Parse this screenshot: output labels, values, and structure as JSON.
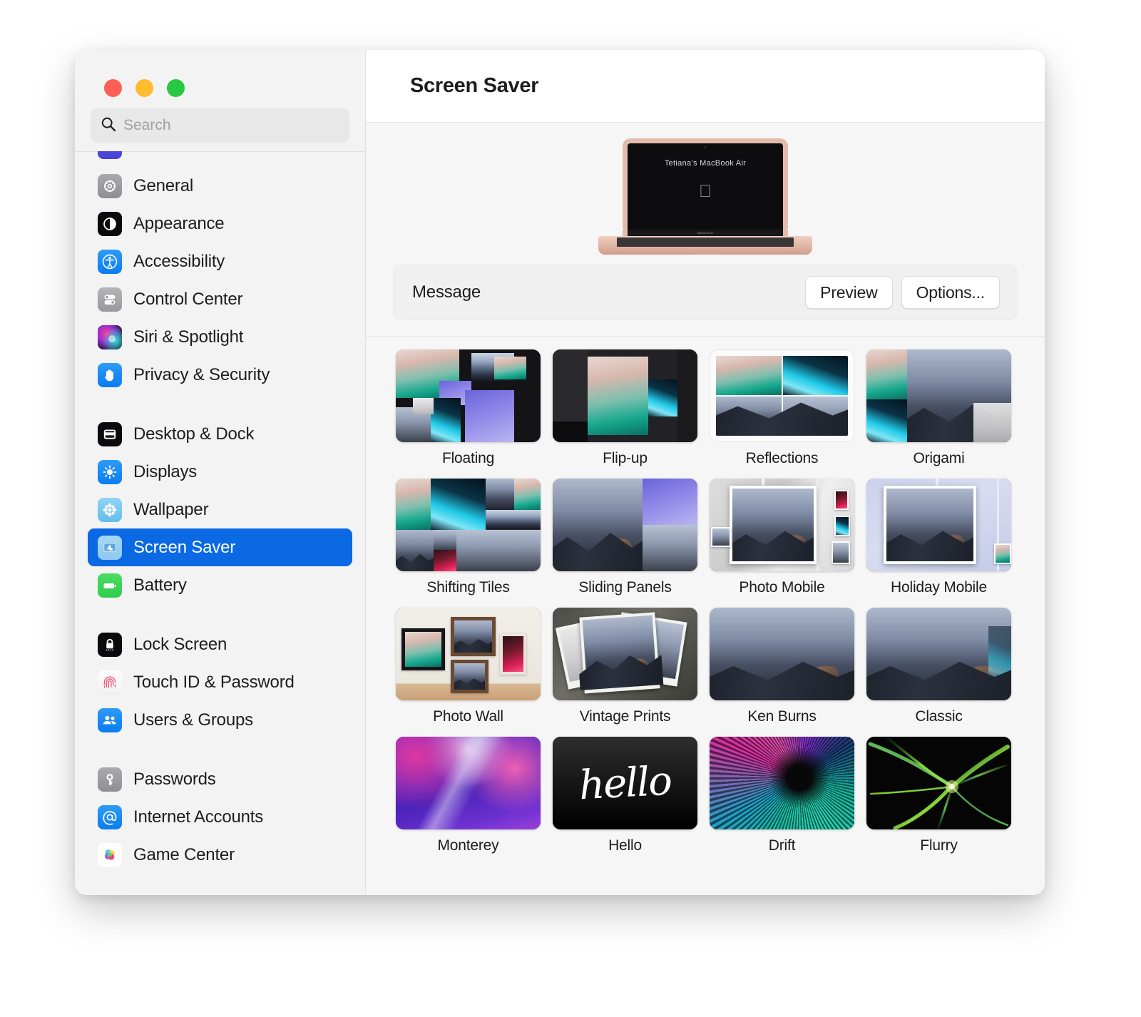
{
  "window": {
    "traffic_lights": [
      "close",
      "minimize",
      "zoom"
    ],
    "colors": {
      "close": "#fd5f57",
      "minimize": "#febc2e",
      "zoom": "#28c840",
      "accent": "#0a69e3"
    }
  },
  "search": {
    "placeholder": "Search",
    "value": "",
    "icon": "search-icon"
  },
  "sidebar": {
    "groups": [
      {
        "items": [
          {
            "label": "General",
            "icon": "gear-icon",
            "selected": false
          },
          {
            "label": "Appearance",
            "icon": "appearance-icon",
            "selected": false
          },
          {
            "label": "Accessibility",
            "icon": "accessibility-icon",
            "selected": false
          },
          {
            "label": "Control Center",
            "icon": "control-center-icon",
            "selected": false
          },
          {
            "label": "Siri & Spotlight",
            "icon": "siri-icon",
            "selected": false
          },
          {
            "label": "Privacy & Security",
            "icon": "hand-icon",
            "selected": false
          }
        ]
      },
      {
        "items": [
          {
            "label": "Desktop & Dock",
            "icon": "desktop-dock-icon",
            "selected": false
          },
          {
            "label": "Displays",
            "icon": "brightness-icon",
            "selected": false
          },
          {
            "label": "Wallpaper",
            "icon": "wallpaper-icon",
            "selected": false
          },
          {
            "label": "Screen Saver",
            "icon": "screen-saver-icon",
            "selected": true
          },
          {
            "label": "Battery",
            "icon": "battery-icon",
            "selected": false
          }
        ]
      },
      {
        "items": [
          {
            "label": "Lock Screen",
            "icon": "lock-icon",
            "selected": false
          },
          {
            "label": "Touch ID & Password",
            "icon": "fingerprint-icon",
            "selected": false
          },
          {
            "label": "Users & Groups",
            "icon": "users-icon",
            "selected": false
          }
        ]
      },
      {
        "items": [
          {
            "label": "Passwords",
            "icon": "key-icon",
            "selected": false
          },
          {
            "label": "Internet Accounts",
            "icon": "at-sign-icon",
            "selected": false
          },
          {
            "label": "Game Center",
            "icon": "game-center-icon",
            "selected": false
          }
        ]
      }
    ]
  },
  "header": {
    "title": "Screen Saver"
  },
  "preview": {
    "device_name": "Tetiana’s MacBook Air",
    "model_label": "MacBook Air",
    "logo": "apple-logo"
  },
  "message_bar": {
    "label": "Message",
    "preview_button": "Preview",
    "options_button": "Options..."
  },
  "screensavers": [
    {
      "label": "Floating",
      "style": "floating",
      "selected": false
    },
    {
      "label": "Flip-up",
      "style": "flipup",
      "selected": false
    },
    {
      "label": "Reflections",
      "style": "reflections",
      "selected": true
    },
    {
      "label": "Origami",
      "style": "origami",
      "selected": false
    },
    {
      "label": "Shifting Tiles",
      "style": "shifting",
      "selected": false
    },
    {
      "label": "Sliding Panels",
      "style": "sliding",
      "selected": false
    },
    {
      "label": "Photo Mobile",
      "style": "photomobile",
      "selected": false
    },
    {
      "label": "Holiday Mobile",
      "style": "holidaymobile",
      "selected": false
    },
    {
      "label": "Photo Wall",
      "style": "photowall",
      "selected": false
    },
    {
      "label": "Vintage Prints",
      "style": "vintage",
      "selected": false
    },
    {
      "label": "Ken Burns",
      "style": "kenburns",
      "selected": false
    },
    {
      "label": "Classic",
      "style": "classic",
      "selected": false
    },
    {
      "label": "Monterey",
      "style": "monterey",
      "selected": false
    },
    {
      "label": "Hello",
      "style": "hello",
      "selected": false
    },
    {
      "label": "Drift",
      "style": "drift",
      "selected": false
    },
    {
      "label": "Flurry",
      "style": "flurry",
      "selected": false
    }
  ],
  "hello_word": "hello"
}
